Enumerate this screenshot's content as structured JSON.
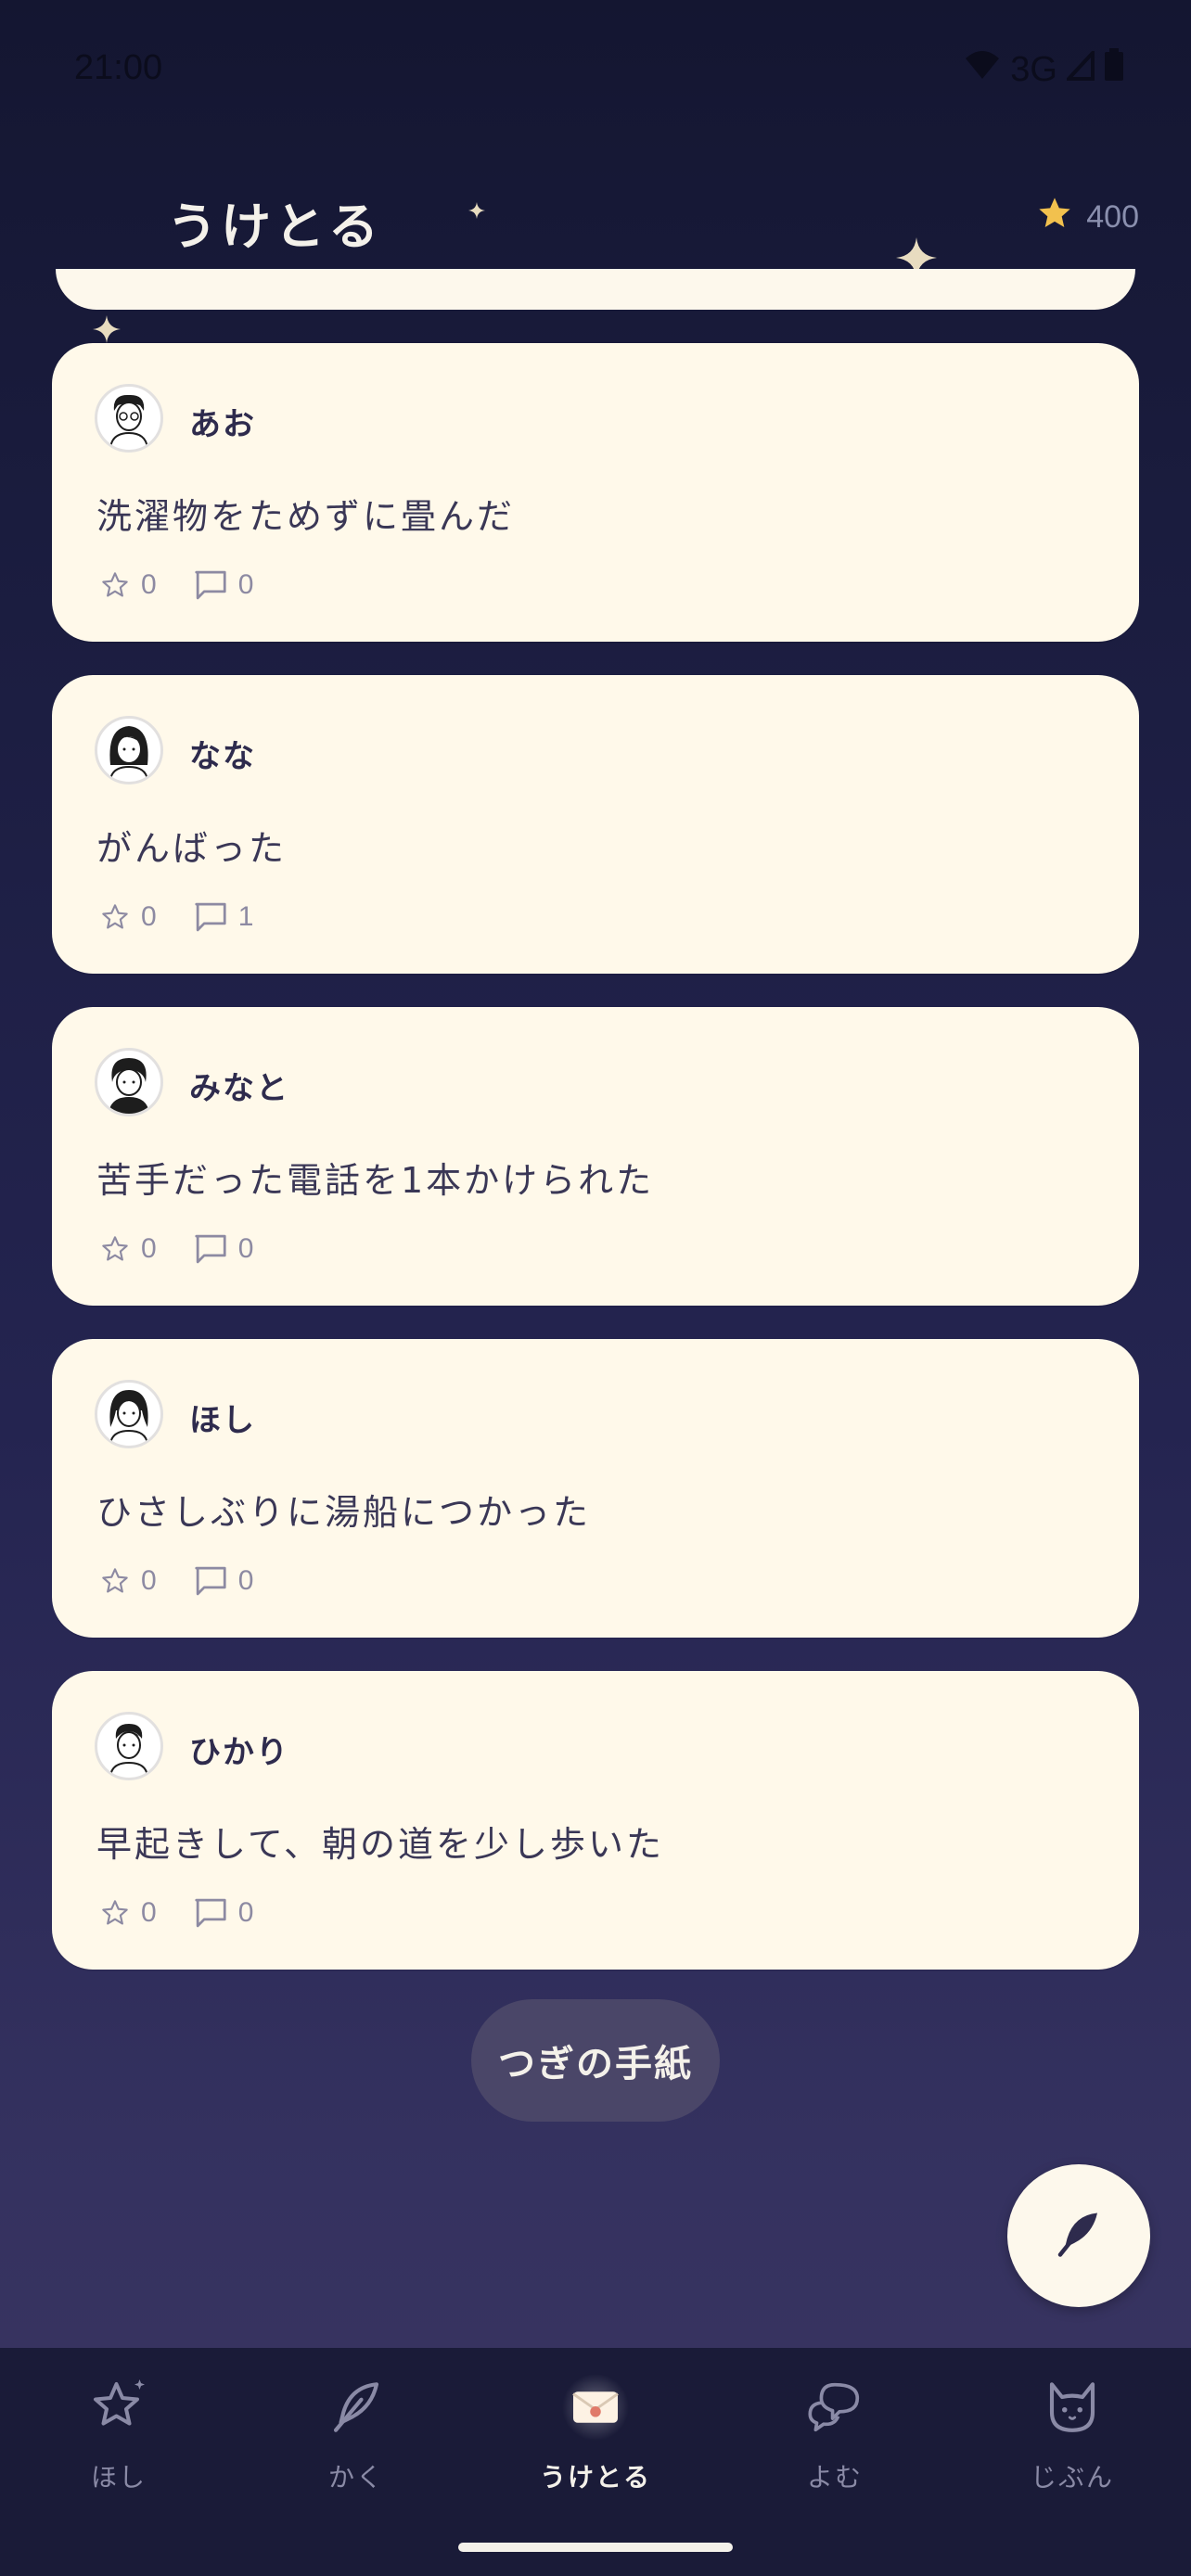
{
  "status_bar": {
    "time": "21:00",
    "network": "3G"
  },
  "header": {
    "title": "うけとる",
    "star_count": "400"
  },
  "letters": [
    {
      "name": "あお",
      "message": "洗濯物をためずに畳んだ",
      "stars": "0",
      "comments": "0"
    },
    {
      "name": "なな",
      "message": "がんばった",
      "stars": "0",
      "comments": "1"
    },
    {
      "name": "みなと",
      "message": "苦手だった電話を1本かけられた",
      "stars": "0",
      "comments": "0"
    },
    {
      "name": "ほし",
      "message": "ひさしぶりに湯船につかった",
      "stars": "0",
      "comments": "0"
    },
    {
      "name": "ひかり",
      "message": "早起きして、朝の道を少し歩いた",
      "stars": "0",
      "comments": "0"
    }
  ],
  "next_button": {
    "label": "つぎの手紙"
  },
  "nav": {
    "items": [
      {
        "label": "ほし",
        "icon": "star-icon"
      },
      {
        "label": "かく",
        "icon": "feather-icon"
      },
      {
        "label": "うけとる",
        "icon": "envelope-icon"
      },
      {
        "label": "よむ",
        "icon": "chat-bubbles-icon"
      },
      {
        "label": "じぶん",
        "icon": "cat-icon"
      }
    ],
    "active": "うけとる"
  },
  "colors": {
    "background": "#1a1c3e",
    "card": "#fff9ea",
    "accent_star": "#f2c14e"
  }
}
